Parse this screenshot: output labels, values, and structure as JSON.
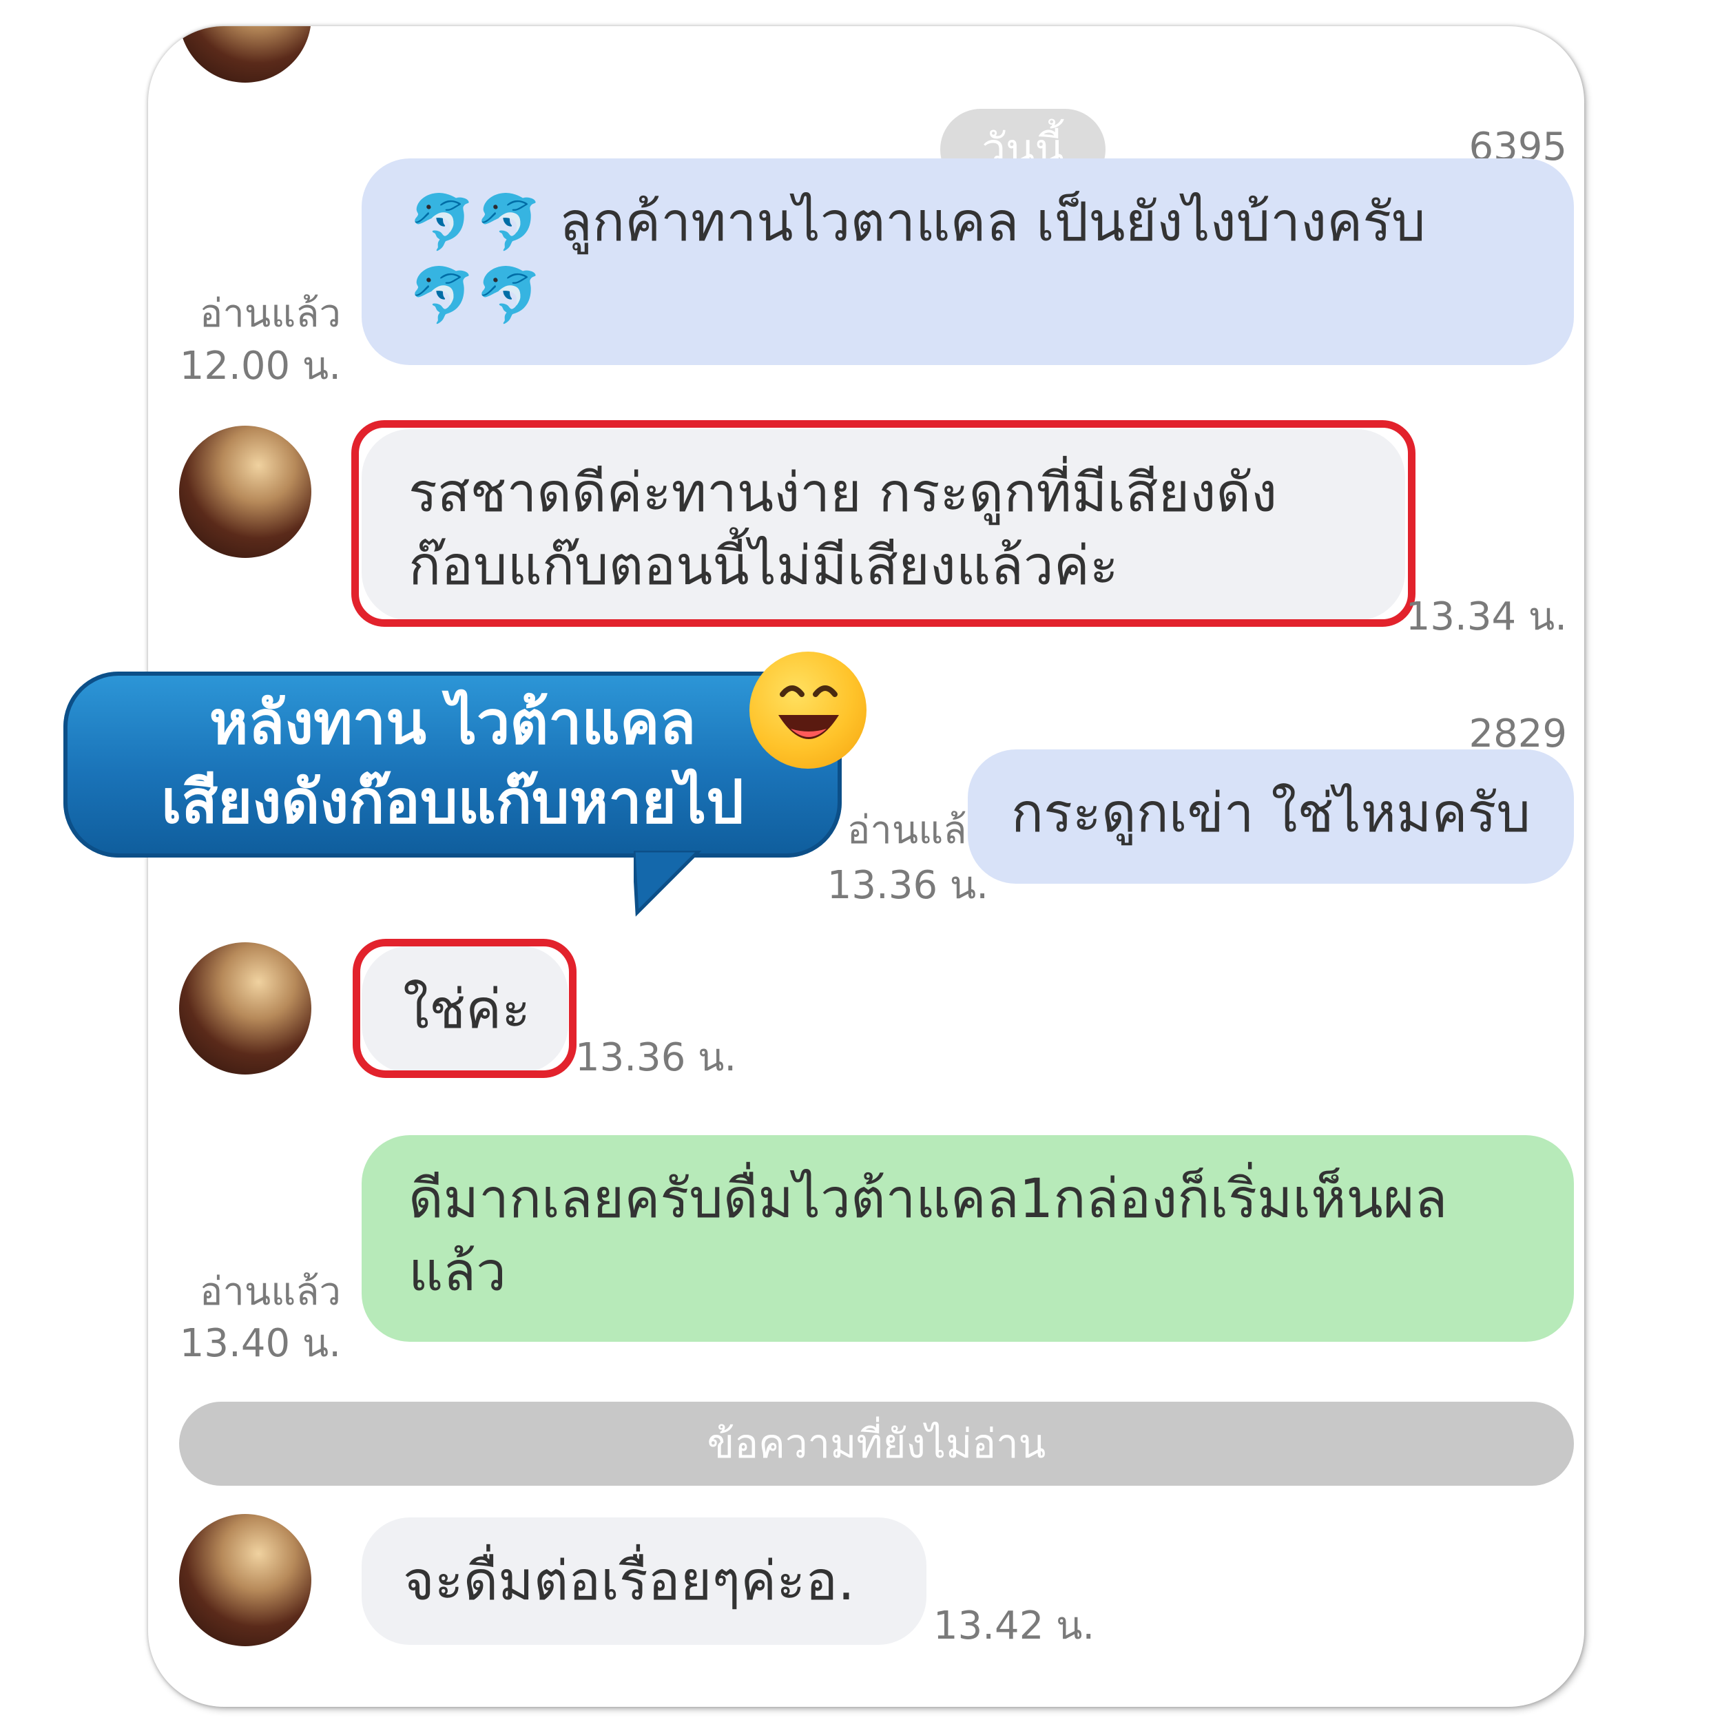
{
  "chat": {
    "date_divider": "วันนี้",
    "messages": [
      {
        "id": "6395",
        "sender": "me",
        "text": "ลูกค้าทานไวตาแคล เป็นยังไงบ้างครับ",
        "emoji": "🐬🐬 🐬🐬",
        "read": "อ่านแล้ว",
        "time": "12.00 น."
      },
      {
        "sender": "customer",
        "line1": "รสชาดดีค่ะทานง่าย กระดูกที่มีเสียงดัง",
        "line2": "ก๊อบแก๊บตอนนี้ไม่มีเสียงแล้วค่ะ",
        "time": "13.34 น."
      },
      {
        "id": "2829",
        "sender": "me",
        "text": "กระดูกเข่า ใช่ไหมครับ",
        "read": "อ่านแล้ว",
        "time": "13.36 น."
      },
      {
        "sender": "customer",
        "text": "ใช่ค่ะ",
        "time": "13.36 น."
      },
      {
        "sender": "me",
        "line1": "ดีมากเลยครับดื่มไวต้าแคล1กล่องก็เริ่มเห็นผล",
        "line2": "แล้ว",
        "read": "อ่านแล้ว",
        "time": "13.40 น."
      },
      {
        "sender": "customer",
        "text": "จะดื่มต่อเรื่อยๆค่ะอ.",
        "time": "13.42 น."
      }
    ],
    "unread_divider": "ข้อความที่ยังไม่อ่าน"
  },
  "callout": {
    "line1": "หลังทาน ไวต้าแคล",
    "line2": "เสียงดังก๊อบแก๊บหายไป",
    "emoji_icon": "grinning-wink-emoji"
  },
  "colors": {
    "highlight_red": "#e2222c",
    "bubble_blue": "#d8e2f8",
    "bubble_green": "#b7eab9",
    "callout_blue": "#1a73b8"
  }
}
